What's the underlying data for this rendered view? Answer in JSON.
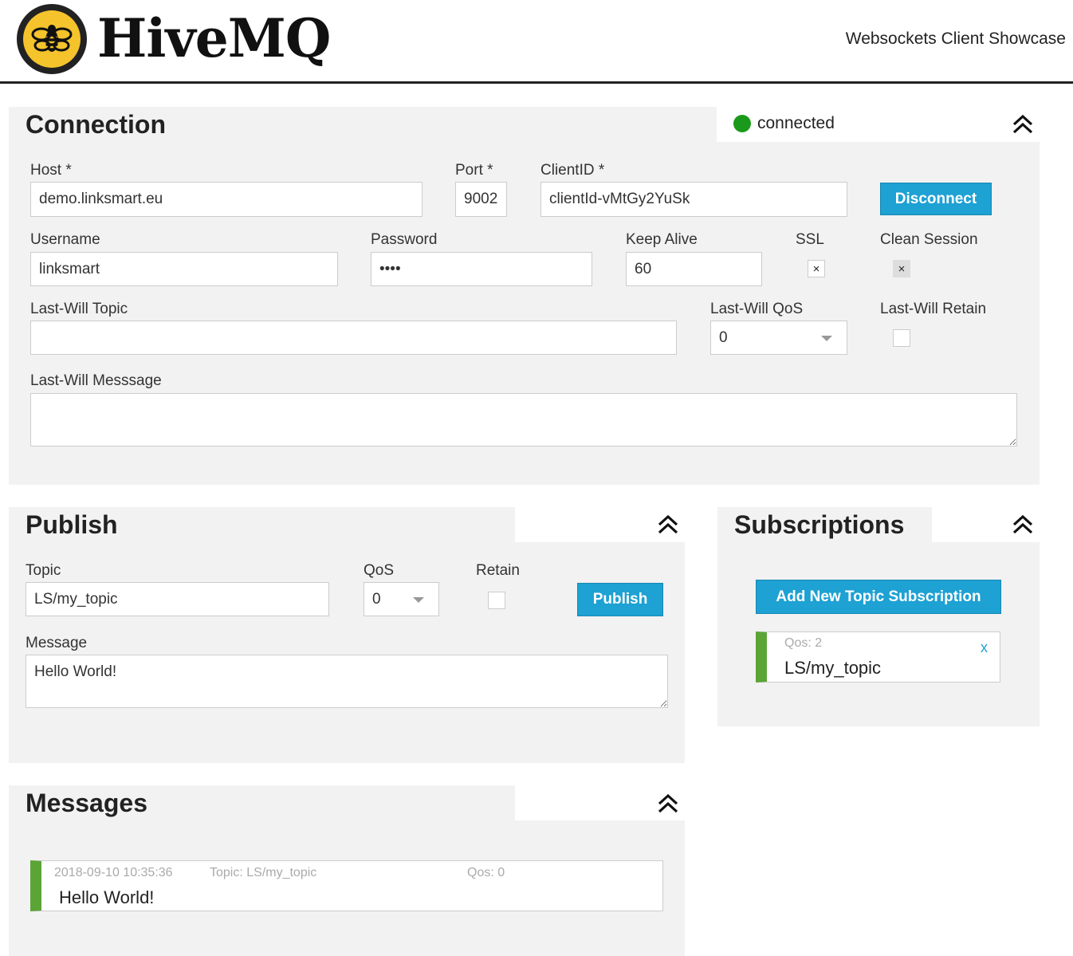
{
  "header": {
    "logo_text": "HiveMQ",
    "tagline": "Websockets Client Showcase"
  },
  "connection": {
    "title": "Connection",
    "status": "connected",
    "status_color": "#1a9a1a",
    "host_label": "Host *",
    "host_value": "demo.linksmart.eu",
    "port_label": "Port *",
    "port_value": "9002",
    "clientid_label": "ClientID *",
    "clientid_value": "clientId-vMtGy2YuSk",
    "disconnect_label": "Disconnect",
    "username_label": "Username",
    "username_value": "linksmart",
    "password_label": "Password",
    "password_value": "••••",
    "keepalive_label": "Keep Alive",
    "keepalive_value": "60",
    "ssl_label": "SSL",
    "ssl_checked": "×",
    "clean_session_label": "Clean Session",
    "clean_session_checked": "×",
    "lw_topic_label": "Last-Will Topic",
    "lw_topic_value": "",
    "lw_qos_label": "Last-Will QoS",
    "lw_qos_value": "0",
    "lw_retain_label": "Last-Will Retain",
    "lw_message_label": "Last-Will Messsage",
    "lw_message_value": ""
  },
  "publish": {
    "title": "Publish",
    "topic_label": "Topic",
    "topic_value": "LS/my_topic",
    "qos_label": "QoS",
    "qos_value": "0",
    "retain_label": "Retain",
    "publish_label": "Publish",
    "message_label": "Message",
    "message_value": "Hello World!"
  },
  "subscriptions": {
    "title": "Subscriptions",
    "add_label": "Add New Topic Subscription",
    "items": [
      {
        "qos": "Qos: 2",
        "topic": "LS/my_topic",
        "remove": "x",
        "color": "#5ba537"
      }
    ]
  },
  "messages": {
    "title": "Messages",
    "items": [
      {
        "timestamp": "2018-09-10 10:35:36",
        "topic": "Topic: LS/my_topic",
        "qos": "Qos: 0",
        "body": "Hello World!",
        "color": "#5ba537"
      }
    ]
  },
  "accent_color": "#1ea1d3"
}
